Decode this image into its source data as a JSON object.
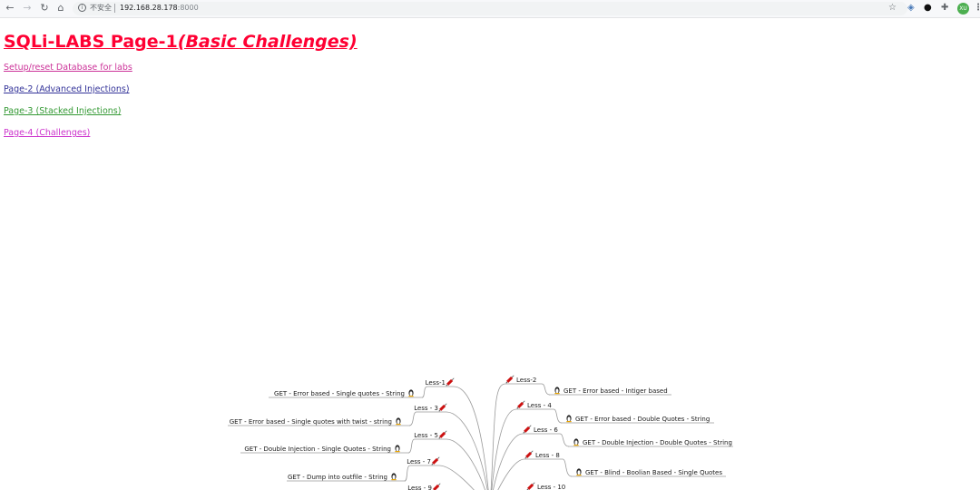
{
  "browser": {
    "security_label": "不安全",
    "url_host": "192.168.28.178",
    "url_port": ":8000",
    "avatar_initials": "XU",
    "icons": [
      "back-arrow-icon",
      "forward-arrow-icon",
      "reload-icon",
      "home-icon",
      "info-icon",
      "star-icon",
      "extension-icon",
      "puzzle-icon",
      "menu-icon"
    ]
  },
  "page": {
    "title_main": "SQLi-LABS Page-1",
    "title_sub": "(Basic Challenges)",
    "title_color": "#ff0033",
    "links": [
      {
        "label": "Setup/reset Database for labs",
        "color": "#cc3399"
      },
      {
        "label": "Page-2 (Advanced Injections)",
        "color": "#333399"
      },
      {
        "label": "Page-3 (Stacked Injections)",
        "color": "#339933"
      },
      {
        "label": "Page-4 (Challenges)",
        "color": "#cc33cc"
      }
    ]
  },
  "mindmap": {
    "left": [
      {
        "lesson": "Less-1",
        "desc": "GET - Error based - Single quotes - String"
      },
      {
        "lesson": "Less - 3",
        "desc": "GET - Error based - Single quotes with twist - string"
      },
      {
        "lesson": "Less - 5",
        "desc": "GET - Double Injection - Single Quotes - String"
      },
      {
        "lesson": "Less - 7",
        "desc": "GET - Dump into outfile - String"
      },
      {
        "lesson": "Less - 9",
        "desc": ""
      }
    ],
    "right": [
      {
        "lesson": "Less-2",
        "desc": "GET - Error based - Intiger based"
      },
      {
        "lesson": "Less - 4",
        "desc": "GET - Error based - Double Quotes - String"
      },
      {
        "lesson": "Less - 6",
        "desc": "GET - Double Injection - Double Quotes - String"
      },
      {
        "lesson": "Less - 8",
        "desc": "GET - Blind - Boolian Based - Single Quotes"
      },
      {
        "lesson": "Less - 10",
        "desc": ""
      }
    ],
    "line_color": "#9a9a9a",
    "syringe_color": "#cc1111"
  }
}
